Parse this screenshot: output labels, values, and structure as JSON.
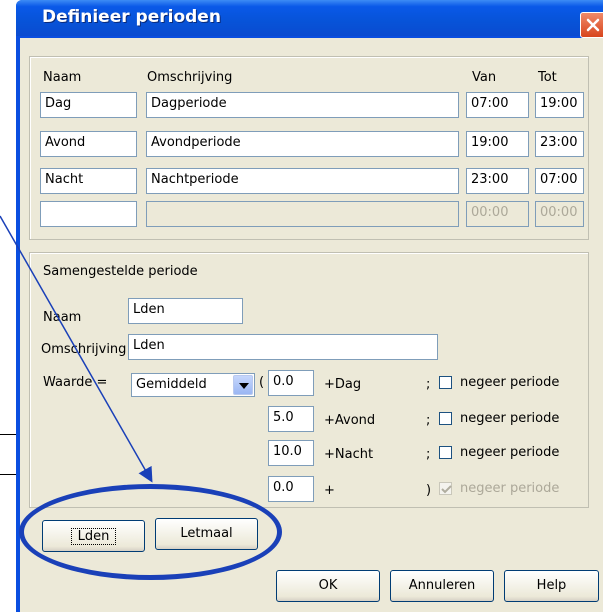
{
  "window": {
    "title": "Definieer perioden"
  },
  "periods": {
    "headers": {
      "naam": "Naam",
      "omschrijving": "Omschrijving",
      "van": "Van",
      "tot": "Tot"
    },
    "rows": [
      {
        "naam": "Dag",
        "omschrijving": "Dagperiode",
        "van": "07:00",
        "tot": "19:00"
      },
      {
        "naam": "Avond",
        "omschrijving": "Avondperiode",
        "van": "19:00",
        "tot": "23:00"
      },
      {
        "naam": "Nacht",
        "omschrijving": "Nachtperiode",
        "van": "23:00",
        "tot": "07:00"
      },
      {
        "naam": "",
        "omschrijving": "",
        "van": "00:00",
        "tot": "00:00"
      }
    ]
  },
  "composite": {
    "title": "Samengestelde periode",
    "naam_label": "Naam",
    "naam_value": "Lden",
    "omschrijving_label": "Omschrijving",
    "omschrijving_value": "Lden",
    "waarde_label": "Waarde =",
    "waarde_selected": "Gemiddeld",
    "open_paren": "(",
    "close_paren": ")",
    "terms": [
      {
        "value": "0.0",
        "name": "+Dag",
        "sep": ";",
        "negeer_label": "negeer periode",
        "checked": false,
        "disabled": false
      },
      {
        "value": "5.0",
        "name": "+Avond",
        "sep": ";",
        "negeer_label": "negeer periode",
        "checked": false,
        "disabled": false
      },
      {
        "value": "10.0",
        "name": "+Nacht",
        "sep": ";",
        "negeer_label": "negeer periode",
        "checked": false,
        "disabled": false
      },
      {
        "value": "0.0",
        "name": "+",
        "sep": "",
        "negeer_label": "negeer periode",
        "checked": true,
        "disabled": true
      }
    ]
  },
  "buttons": {
    "lden": "Lden",
    "letmaal": "Letmaal",
    "ok": "OK",
    "annuleren": "Annuleren",
    "help": "Help"
  },
  "colors": {
    "titlebar": "#0753d8",
    "dialog_bg": "#ece9d8",
    "annotation": "#1a40b8"
  }
}
